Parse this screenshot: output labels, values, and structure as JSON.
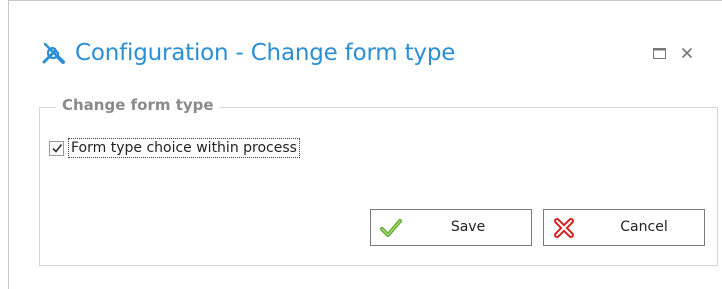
{
  "window": {
    "title": "Configuration - Change form type",
    "title_icon": "tools-icon",
    "maximize_icon": "maximize-icon",
    "close_icon": "close-icon"
  },
  "group": {
    "legend": "Change form type",
    "checkbox": {
      "label": "Form type choice within process",
      "checked": true
    }
  },
  "buttons": {
    "save_label": "Save",
    "save_icon": "checkmark-icon",
    "cancel_label": "Cancel",
    "cancel_icon": "red-x-icon"
  },
  "colors": {
    "title": "#2b8fd6",
    "save_icon": "#5aa832",
    "cancel_icon": "#d42222"
  }
}
